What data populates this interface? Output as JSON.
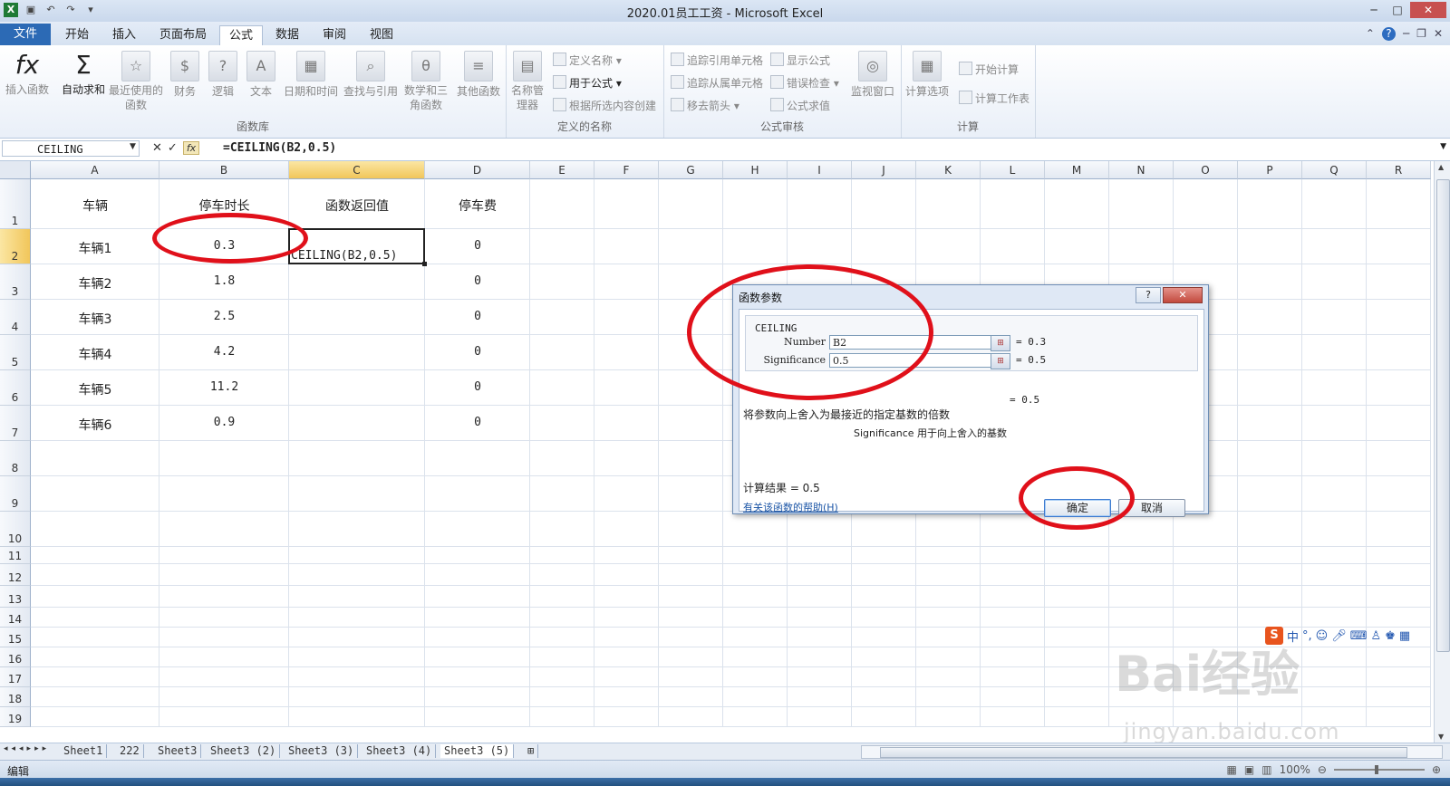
{
  "window": {
    "title": "2020.01员工工资 - Microsoft Excel",
    "qat_icons": [
      "excel-app-icon",
      "save-icon",
      "undo-icon",
      "redo-icon",
      "customize-qat-icon"
    ]
  },
  "tabs": [
    "文件",
    "开始",
    "插入",
    "页面布局",
    "公式",
    "数据",
    "审阅",
    "视图"
  ],
  "active_tab": "公式",
  "ribbon": {
    "function_library": {
      "label": "函数库",
      "buttons": [
        "插入函数",
        "自动求和",
        "最近使用的函数",
        "财务",
        "逻辑",
        "文本",
        "日期和时间",
        "查找与引用",
        "数学和三角函数",
        "其他函数"
      ]
    },
    "defined_names": {
      "label": "定义的名称",
      "name_manager": "名称管理器",
      "items": [
        "定义名称",
        "用于公式",
        "根据所选内容创建"
      ]
    },
    "formula_auditing": {
      "label": "公式审核",
      "items": [
        "追踪引用单元格",
        "追踪从属单元格",
        "移去箭头",
        "显示公式",
        "错误检查",
        "公式求值"
      ],
      "watch_window": "监视窗口"
    },
    "calculation": {
      "label": "计算",
      "options": "计算选项",
      "items": [
        "开始计算",
        "计算工作表"
      ]
    }
  },
  "formula_bar": {
    "name_box": "CEILING",
    "formula": "=CEILING(B2,0.5)"
  },
  "grid": {
    "columns": [
      "A",
      "B",
      "C",
      "D",
      "E",
      "F",
      "G",
      "H",
      "I",
      "J",
      "K",
      "L",
      "M",
      "N",
      "O",
      "P",
      "Q",
      "R"
    ],
    "rows": [
      "1",
      "2",
      "3",
      "4",
      "5",
      "6",
      "7",
      "8",
      "9",
      "10",
      "11",
      "12",
      "13",
      "14",
      "15",
      "16",
      "17",
      "18",
      "19"
    ],
    "selected_column": "C",
    "selected_row": "2",
    "headers": [
      "车辆",
      "停车时长",
      "函数返回值",
      "停车费"
    ],
    "data": [
      {
        "vehicle": "车辆1",
        "duration": "0.3",
        "fee": "0"
      },
      {
        "vehicle": "车辆2",
        "duration": "1.8",
        "fee": "0"
      },
      {
        "vehicle": "车辆3",
        "duration": "2.5",
        "fee": "0"
      },
      {
        "vehicle": "车辆4",
        "duration": "4.2",
        "fee": "0"
      },
      {
        "vehicle": "车辆5",
        "duration": "11.2",
        "fee": "0"
      },
      {
        "vehicle": "车辆6",
        "duration": "0.9",
        "fee": "0"
      }
    ],
    "editing_text": "CEILING(B2,0.5)"
  },
  "dialog": {
    "title": "函数参数",
    "function_name": "CEILING",
    "args": [
      {
        "label": "Number",
        "value": "B2",
        "result": "= 0.3"
      },
      {
        "label": "Significance",
        "value": "0.5",
        "result": "= 0.5"
      }
    ],
    "result": "= 0.5",
    "description": "将参数向上舍入为最接近的指定基数的倍数",
    "arg_description": "Significance  用于向上舍入的基数",
    "calc_result": "计算结果 = 0.5",
    "help_link": "有关该函数的帮助(H)",
    "ok": "确定",
    "cancel": "取消"
  },
  "sheet_tabs": [
    "Sheet1",
    "222",
    "Sheet3",
    "Sheet3 (2)",
    "Sheet3 (3)",
    "Sheet3 (4)",
    "Sheet3 (5)"
  ],
  "active_sheet": "Sheet3 (5)",
  "status": {
    "mode": "编辑",
    "zoom": "100%"
  },
  "ime": {
    "label": "中"
  },
  "watermark": {
    "main": "Bai经验",
    "sub": "jingyan.baidu.com"
  },
  "colors": {
    "annotation_red": "#e0101a",
    "file_tab": "#2c6ab5",
    "selected_header": "#f1c65a"
  }
}
